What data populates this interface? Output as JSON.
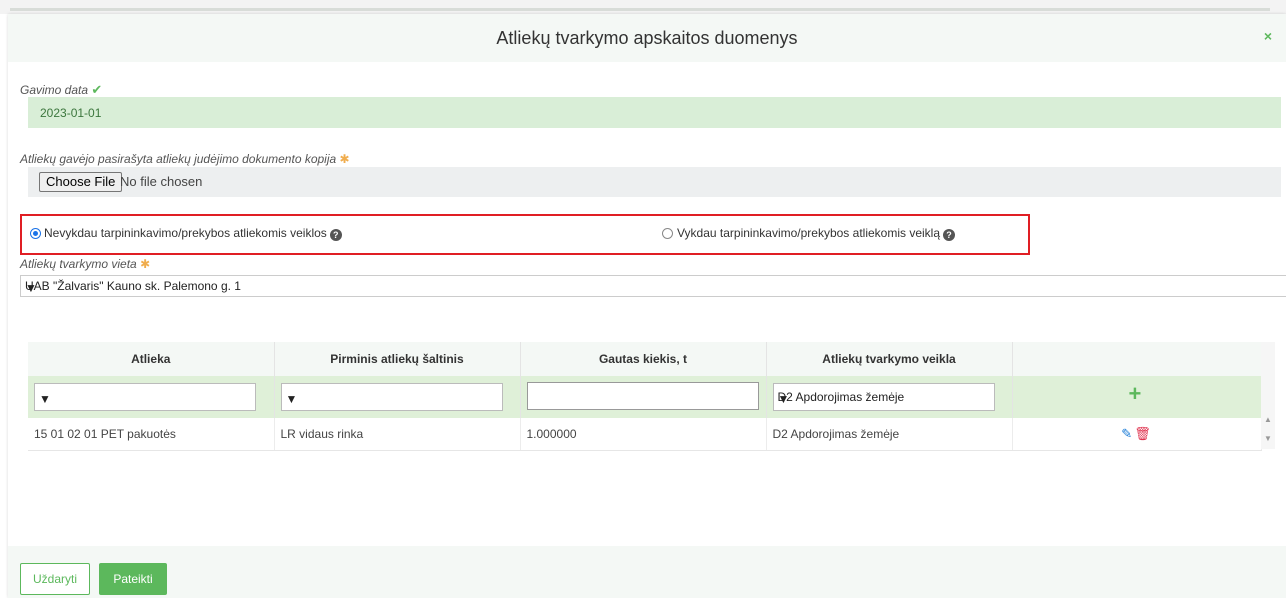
{
  "modal": {
    "title": "Atliekų tvarkymo apskaitos duomenys",
    "close_glyph": "×"
  },
  "form": {
    "date_label": "Gavimo data",
    "date_value": "2023-01-01",
    "file_label": "Atliekų gavėjo pasirašyta atliekų judėjimo dokumento kopija",
    "file_button": "Choose File",
    "file_status": "No file chosen",
    "radio_option_1": "Nevykdau tarpininkavimo/prekybos atliekomis veiklos",
    "radio_option_2": "Vykdau tarpininkavimo/prekybos atliekomis veiklą",
    "radio_selected": 1,
    "place_label": "Atliekų tvarkymo vieta",
    "place_value": "UAB \"Žalvaris\" Kauno sk. Palemono g. 1"
  },
  "table": {
    "headers": [
      "Atlieka",
      "Pirminis atliekų šaltinis",
      "Gautas kiekis, t",
      "Atliekų tvarkymo veikla",
      ""
    ],
    "input_row": {
      "activity_default": "D2 Apdorojimas žemėje"
    },
    "rows": [
      {
        "waste": "15 01 02 01 PET pakuotės",
        "source": "LR vidaus rinka",
        "amount": "1.000000",
        "activity": "D2 Apdorojimas žemėje"
      }
    ]
  },
  "footer": {
    "close_label": "Uždaryti",
    "submit_label": "Pateikti"
  },
  "colors": {
    "accent_green": "#5cb85c",
    "highlight_red": "#e01e24"
  }
}
